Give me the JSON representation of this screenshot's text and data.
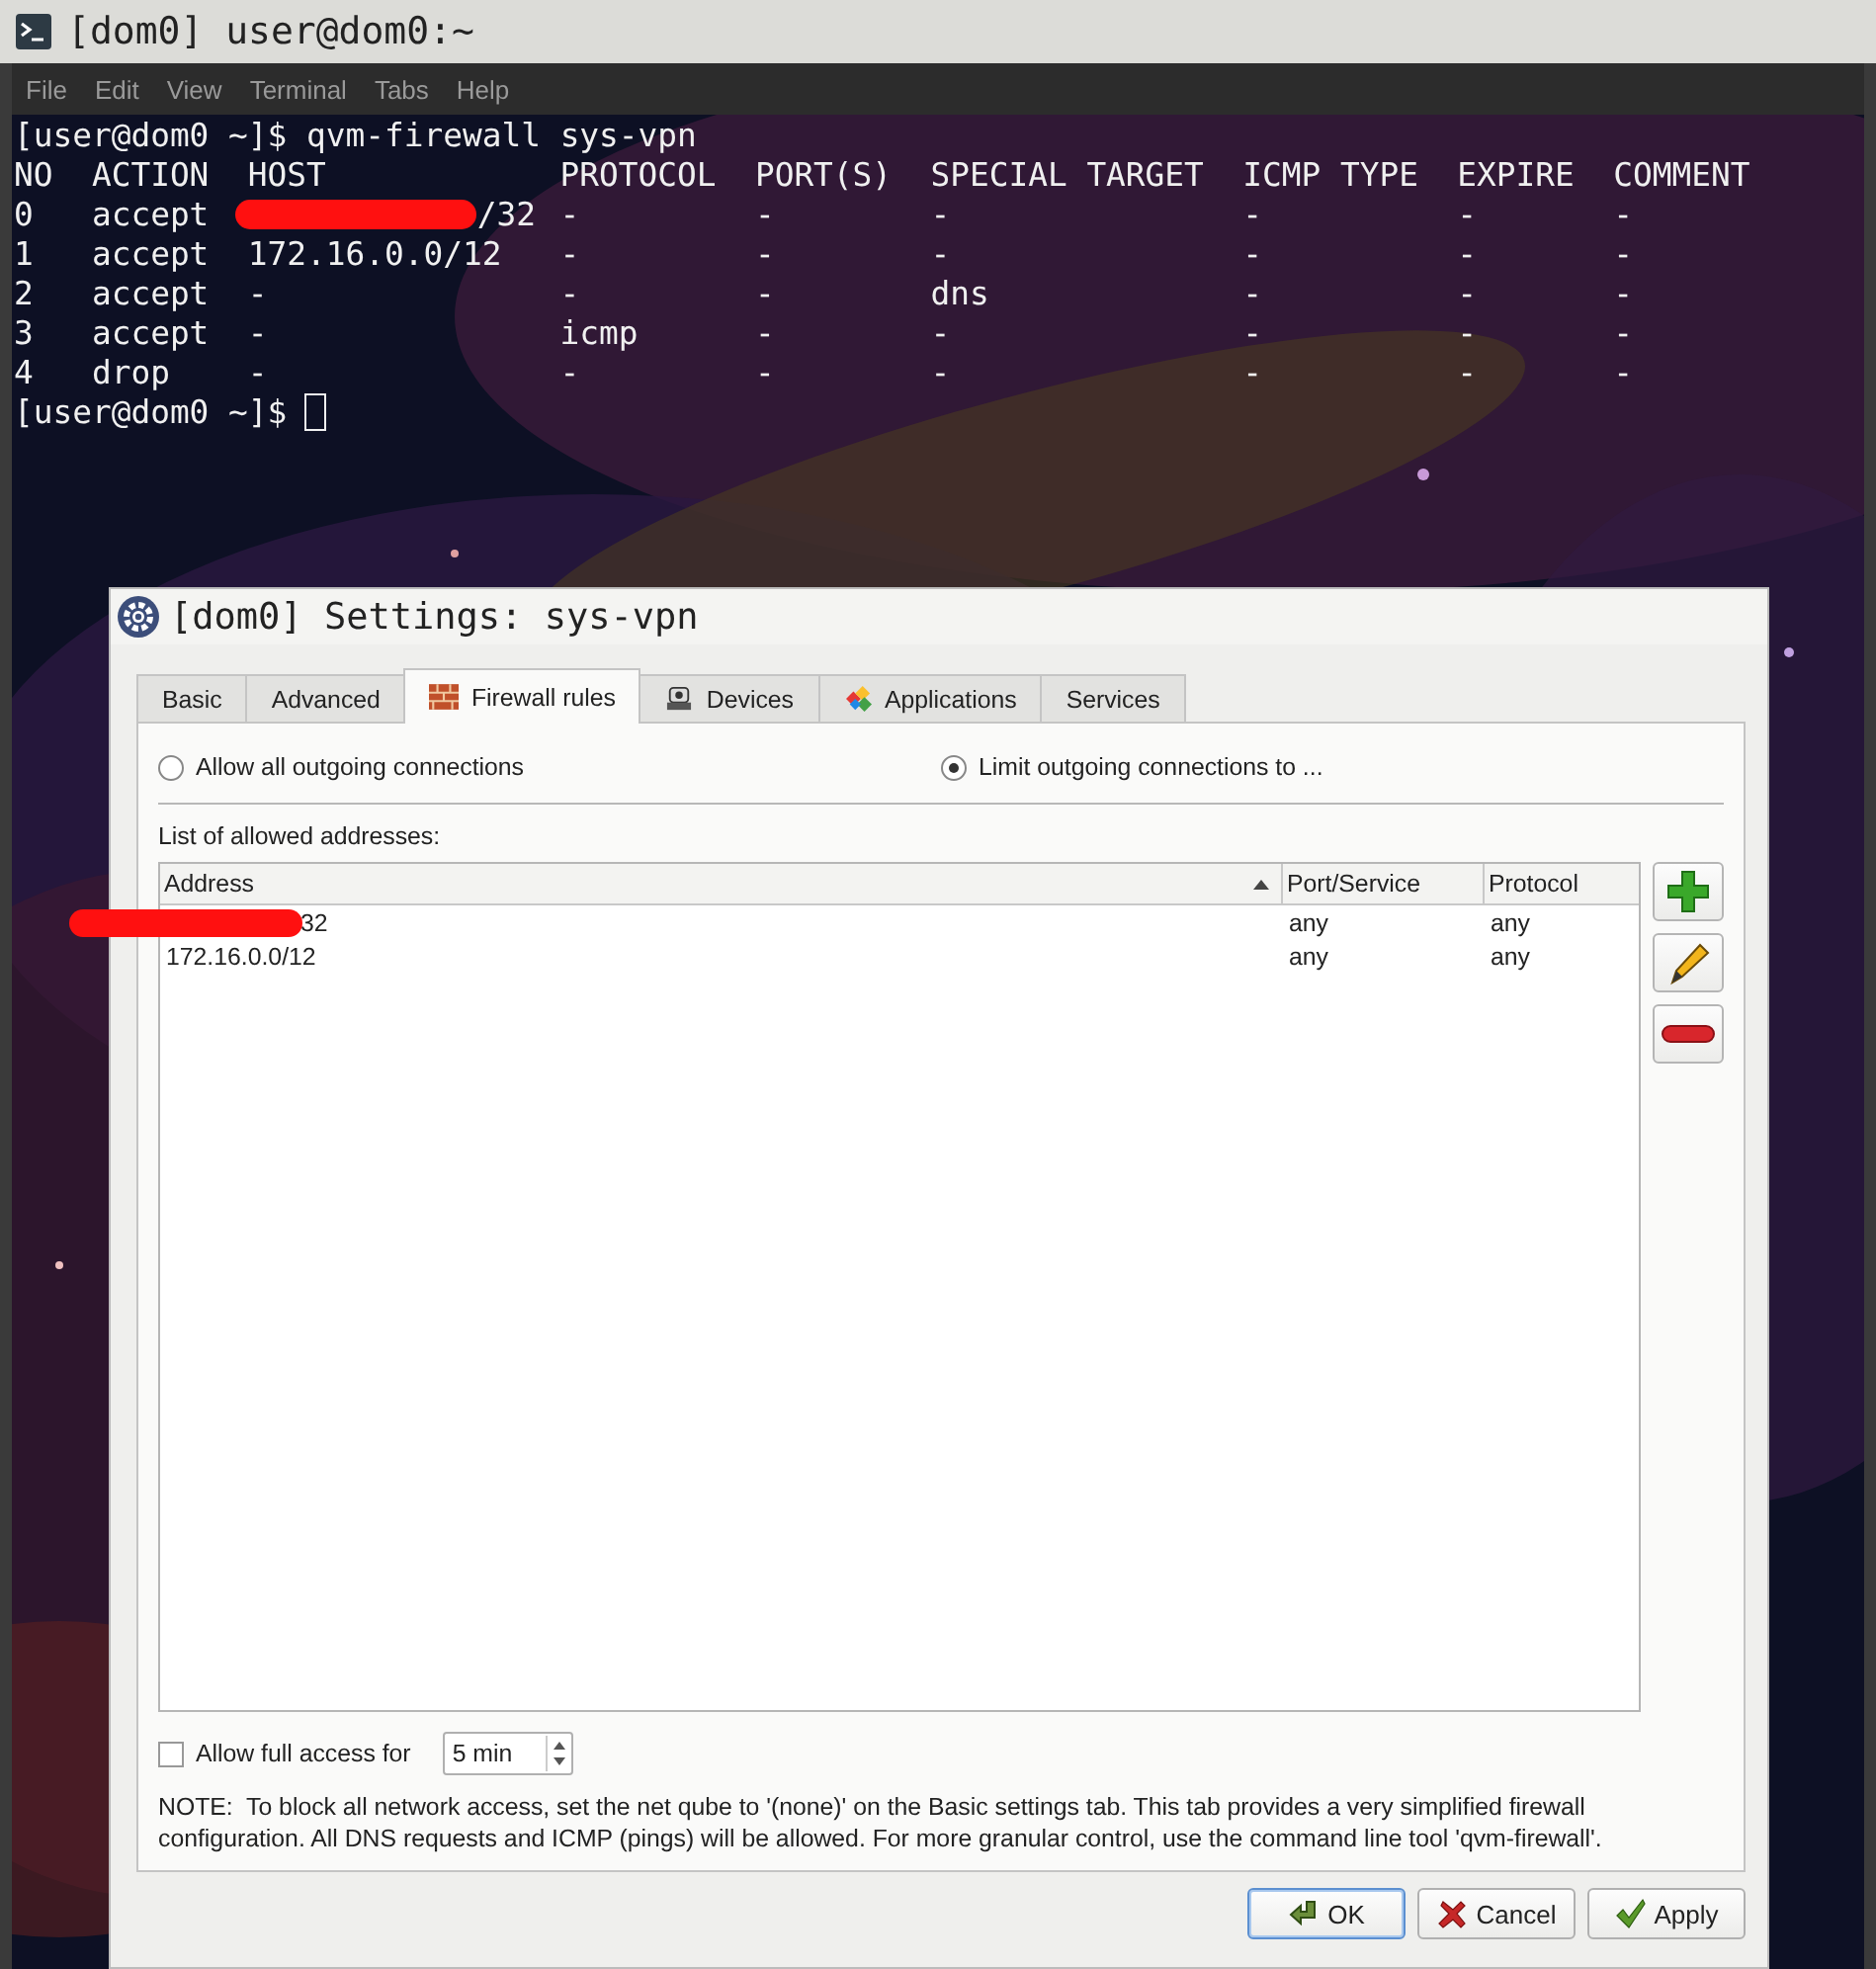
{
  "terminal": {
    "title": "[dom0] user@dom0:~",
    "menu": [
      "File",
      "Edit",
      "View",
      "Terminal",
      "Tabs",
      "Help"
    ],
    "command_line": {
      "prompt": "[user@dom0 ~]$",
      "command": "qvm-firewall sys-vpn"
    },
    "output": {
      "columns": [
        "NO",
        "ACTION",
        "HOST",
        "PROTOCOL",
        "PORT(S)",
        "SPECIAL TARGET",
        "ICMP TYPE",
        "EXPIRE",
        "COMMENT"
      ],
      "rows": [
        {
          "cells": [
            "0",
            "accept",
            "/32",
            "-",
            "-",
            "-",
            "-",
            "-",
            "-"
          ],
          "redacted": true
        },
        {
          "cells": [
            "1",
            "accept",
            "172.16.0.0/12",
            "-",
            "-",
            "-",
            "-",
            "-",
            "-"
          ],
          "redacted": false
        },
        {
          "cells": [
            "2",
            "accept",
            "-",
            "-",
            "-",
            "dns",
            "-",
            "-",
            "-"
          ],
          "redacted": false
        },
        {
          "cells": [
            "3",
            "accept",
            "-",
            "icmp",
            "-",
            "-",
            "-",
            "-",
            "-"
          ],
          "redacted": false
        },
        {
          "cells": [
            "4",
            "drop",
            "-",
            "-",
            "-",
            "-",
            "-",
            "-",
            "-"
          ],
          "redacted": false
        }
      ]
    },
    "prompt_line": {
      "prompt": "[user@dom0 ~]$",
      "cursor": true
    }
  },
  "dialog": {
    "title": "[dom0] Settings: sys-vpn",
    "tabs": [
      {
        "label": "Basic",
        "kind": "plain",
        "selected": false
      },
      {
        "label": "Advanced",
        "kind": "plain",
        "selected": false
      },
      {
        "label": "Firewall rules",
        "kind": "firewall",
        "selected": true
      },
      {
        "label": "Devices",
        "kind": "devices",
        "selected": false
      },
      {
        "label": "Applications",
        "kind": "applications",
        "selected": false
      },
      {
        "label": "Services",
        "kind": "plain",
        "selected": false
      }
    ],
    "radios": [
      {
        "label": "Allow all outgoing connections",
        "selected": false
      },
      {
        "label": "Limit outgoing connections to ...",
        "selected": true
      }
    ],
    "list_label": "List of allowed addresses:",
    "table": {
      "columns": [
        {
          "label": "Address",
          "sorted": true
        },
        {
          "label": "Port/Service",
          "sorted": false
        },
        {
          "label": "Protocol",
          "sorted": false
        }
      ],
      "rows": [
        {
          "cells": [
            "32",
            "any",
            "any"
          ],
          "redacted": true
        },
        {
          "cells": [
            "172.16.0.0/12",
            "any",
            "any"
          ],
          "redacted": false
        }
      ]
    },
    "side_buttons": [
      {
        "kind": "add"
      },
      {
        "kind": "edit"
      },
      {
        "kind": "remove"
      }
    ],
    "full_access": {
      "label": "Allow full access for",
      "checked": false,
      "value": "5 min"
    },
    "note": "NOTE:  To block all network access, set the net qube to '(none)' on the Basic settings tab. This tab provides a very simplified firewall configuration. All DNS requests and ICMP (pings) will be allowed. For more granular control, use the command line tool 'qvm-firewall'.",
    "buttons": [
      {
        "label": "OK",
        "kind": "ok",
        "default": true
      },
      {
        "label": "Cancel",
        "kind": "cancel",
        "default": false
      },
      {
        "label": "Apply",
        "kind": "apply",
        "default": false
      }
    ]
  }
}
